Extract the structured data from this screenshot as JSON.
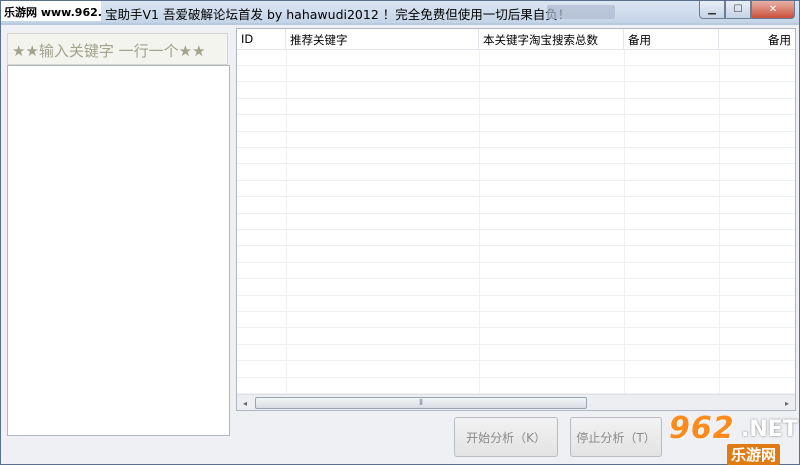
{
  "watermark_site": "乐游网 www.962.net",
  "window": {
    "title": "宝助手V1 吾爱破解论坛首发 by hahawudi2012 ！完全免费但使用一切后果自负！",
    "minimize_icon": "minimize-icon",
    "maximize_icon": "maximize-icon",
    "close_icon": "close-icon"
  },
  "left_panel": {
    "header": "★★输入关键字 一行一个★★"
  },
  "table": {
    "columns": [
      "ID",
      "推荐关键字",
      "本关键字淘宝搜索总数",
      "备用",
      "备用"
    ],
    "rows": []
  },
  "buttons": {
    "start": "开始分析（K）",
    "stop": "停止分析（T）"
  },
  "scrollbar": {
    "left_arrow": "◂",
    "right_arrow": "▸",
    "grip": "⦀"
  },
  "watermark": {
    "number": "962",
    "net": ".NET",
    "cn": "乐游网"
  }
}
